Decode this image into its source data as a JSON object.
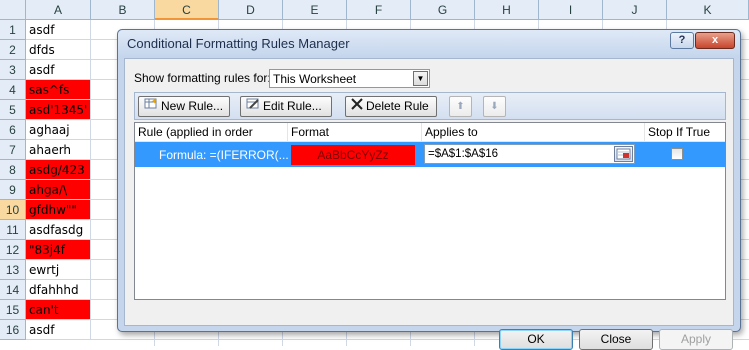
{
  "spreadsheet": {
    "columns": [
      "A",
      "B",
      "C",
      "D",
      "E",
      "F",
      "G",
      "H",
      "I",
      "J",
      "K"
    ],
    "selected_column": "C",
    "selected_row": "10",
    "rows": [
      {
        "num": "1",
        "a": "asdf",
        "highlight": false
      },
      {
        "num": "2",
        "a": "dfds",
        "highlight": false
      },
      {
        "num": "3",
        "a": "asdf",
        "highlight": false
      },
      {
        "num": "4",
        "a": "sas^fs",
        "highlight": true
      },
      {
        "num": "5",
        "a": "asd'1345'",
        "highlight": true
      },
      {
        "num": "6",
        "a": "aghaaj",
        "highlight": false
      },
      {
        "num": "7",
        "a": "ahaerh",
        "highlight": false
      },
      {
        "num": "8",
        "a": "asdg/423",
        "highlight": true
      },
      {
        "num": "9",
        "a": "ahga/\\",
        "highlight": true
      },
      {
        "num": "10",
        "a": "gfdhw\"\"",
        "highlight": true
      },
      {
        "num": "11",
        "a": "asdfasdg",
        "highlight": false
      },
      {
        "num": "12",
        "a": "\"83j4f",
        "highlight": true
      },
      {
        "num": "13",
        "a": "ewrtj",
        "highlight": false
      },
      {
        "num": "14",
        "a": "dfahhhd",
        "highlight": false
      },
      {
        "num": "15",
        "a": "can't",
        "highlight": true
      },
      {
        "num": "16",
        "a": "asdf",
        "highlight": false
      }
    ],
    "highlight_color": "#ff0000"
  },
  "dialog": {
    "title": "Conditional Formatting Rules Manager",
    "help_icon": "?",
    "close_icon": "x",
    "show_rules_label": "Show formatting rules for:",
    "show_rules_value": "This Worksheet",
    "toolbar": {
      "new_rule": "New Rule...",
      "edit_rule": "Edit Rule...",
      "delete_rule": "Delete Rule"
    },
    "columns": {
      "rule": "Rule (applied in order shown)",
      "format": "Format",
      "applies_to": "Applies to",
      "stop_if_true": "Stop If True"
    },
    "rule": {
      "formula": "Formula: =(IFERROR(...",
      "format_preview": "AaBbCcYyZz",
      "applies_to": "=$A$1:$A$16",
      "stop_if_true": false
    },
    "buttons": {
      "ok": "OK",
      "close": "Close",
      "apply": "Apply"
    },
    "selection_color": "#3399ff"
  }
}
